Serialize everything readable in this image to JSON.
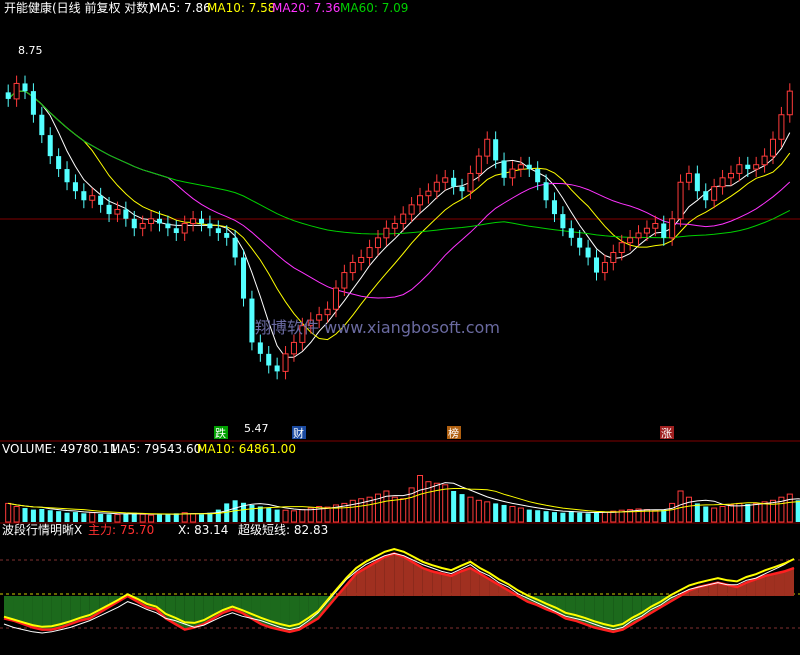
{
  "header": {
    "title": "开能健康(日线 前复权 对数)",
    "ma5": "MA5: 7.86",
    "ma10": "MA10: 7.58",
    "ma20": "MA20: 7.36",
    "ma60": "MA60: 7.09",
    "high_label": "8.75",
    "low_label": "5.47",
    "watermark": "翔博软件 www.xiangbosoft.com",
    "events": [
      "跌",
      "财",
      "榜",
      "涨"
    ]
  },
  "volume": {
    "label": "VOLUME: 49780.11",
    "ma5": "MA5: 79543.60",
    "ma10": "MA10: 64861.00"
  },
  "indicator": {
    "name": "波段行情明晰X",
    "main": "主力: 75.70",
    "x": "X: 83.14",
    "super": "超级短线: 82.83"
  },
  "colors": {
    "up": "#ff3b3b",
    "down": "#54ffff",
    "ma5": "#ffffff",
    "ma10": "#ffff00",
    "ma20": "#ff33ff",
    "ma60": "#00d000",
    "green_fill": "#1c6a1c",
    "red_fill": "#a03020"
  },
  "chart_data": {
    "type": "candlestick",
    "price_range": [
      5.0,
      9.5
    ],
    "high": 8.75,
    "low": 5.47,
    "closes": [
      8.4,
      8.6,
      8.5,
      8.2,
      7.95,
      7.7,
      7.55,
      7.4,
      7.3,
      7.2,
      7.25,
      7.15,
      7.05,
      7.1,
      7.0,
      6.9,
      6.95,
      7.0,
      6.95,
      6.9,
      6.85,
      6.95,
      7.0,
      6.95,
      6.9,
      6.85,
      6.8,
      6.6,
      6.2,
      5.8,
      5.7,
      5.6,
      5.55,
      5.7,
      5.8,
      5.95,
      6.0,
      6.05,
      6.1,
      6.3,
      6.45,
      6.55,
      6.6,
      6.7,
      6.8,
      6.9,
      6.95,
      7.05,
      7.15,
      7.25,
      7.3,
      7.4,
      7.45,
      7.35,
      7.3,
      7.5,
      7.7,
      7.9,
      7.65,
      7.45,
      7.55,
      7.6,
      7.55,
      7.4,
      7.2,
      7.05,
      6.9,
      6.8,
      6.7,
      6.6,
      6.45,
      6.55,
      6.65,
      6.75,
      6.8,
      6.85,
      6.9,
      6.95,
      6.8,
      7.0,
      7.4,
      7.5,
      7.3,
      7.2,
      7.35,
      7.45,
      7.5,
      7.6,
      7.55,
      7.6,
      7.7,
      7.9,
      8.2,
      8.5
    ],
    "volume_range": [
      0,
      200000
    ],
    "volumes": [
      60000,
      50000,
      45000,
      40000,
      42000,
      38000,
      35000,
      30000,
      32000,
      28000,
      30000,
      26000,
      25000,
      24000,
      26000,
      30000,
      25000,
      22000,
      24000,
      26000,
      28000,
      30000,
      27000,
      25000,
      30000,
      40000,
      60000,
      70000,
      62000,
      55000,
      50000,
      45000,
      40000,
      38000,
      36000,
      40000,
      45000,
      50000,
      48000,
      55000,
      60000,
      70000,
      75000,
      80000,
      90000,
      100000,
      80000,
      75000,
      110000,
      150000,
      130000,
      125000,
      120000,
      100000,
      90000,
      80000,
      70000,
      65000,
      60000,
      55000,
      50000,
      45000,
      40000,
      38000,
      35000,
      32000,
      30000,
      35000,
      30000,
      28000,
      30000,
      32000,
      35000,
      38000,
      40000,
      42000,
      40000,
      38000,
      40000,
      60000,
      100000,
      80000,
      60000,
      50000,
      45000,
      50000,
      55000,
      60000,
      58000,
      60000,
      65000,
      70000,
      80000,
      90000,
      70000,
      50000
    ],
    "indicator_range": [
      0,
      100
    ],
    "main": [
      30,
      28,
      25,
      22,
      20,
      20,
      22,
      25,
      28,
      30,
      35,
      40,
      45,
      50,
      45,
      40,
      38,
      30,
      25,
      20,
      22,
      25,
      30,
      35,
      38,
      35,
      30,
      25,
      22,
      20,
      18,
      20,
      25,
      30,
      40,
      50,
      60,
      70,
      75,
      80,
      85,
      88,
      85,
      80,
      75,
      72,
      70,
      68,
      72,
      75,
      70,
      65,
      60,
      55,
      50,
      45,
      42,
      38,
      35,
      30,
      28,
      25,
      22,
      20,
      18,
      20,
      25,
      30,
      35,
      40,
      45,
      50,
      55,
      58,
      60,
      62,
      60,
      58,
      62,
      65,
      68,
      70,
      72,
      75
    ],
    "x": [
      25,
      22,
      20,
      18,
      17,
      18,
      20,
      22,
      25,
      28,
      32,
      36,
      40,
      45,
      42,
      38,
      35,
      30,
      28,
      25,
      22,
      24,
      28,
      32,
      35,
      32,
      30,
      28,
      25,
      22,
      20,
      22,
      28,
      35,
      45,
      55,
      65,
      72,
      78,
      82,
      86,
      88,
      86,
      82,
      78,
      75,
      72,
      70,
      74,
      78,
      72,
      68,
      62,
      58,
      52,
      48,
      44,
      40,
      36,
      32,
      30,
      28,
      25,
      22,
      20,
      22,
      28,
      32,
      38,
      42,
      48,
      52,
      56,
      58,
      60,
      62,
      60,
      60,
      64,
      66,
      70,
      74,
      78,
      83
    ]
  }
}
